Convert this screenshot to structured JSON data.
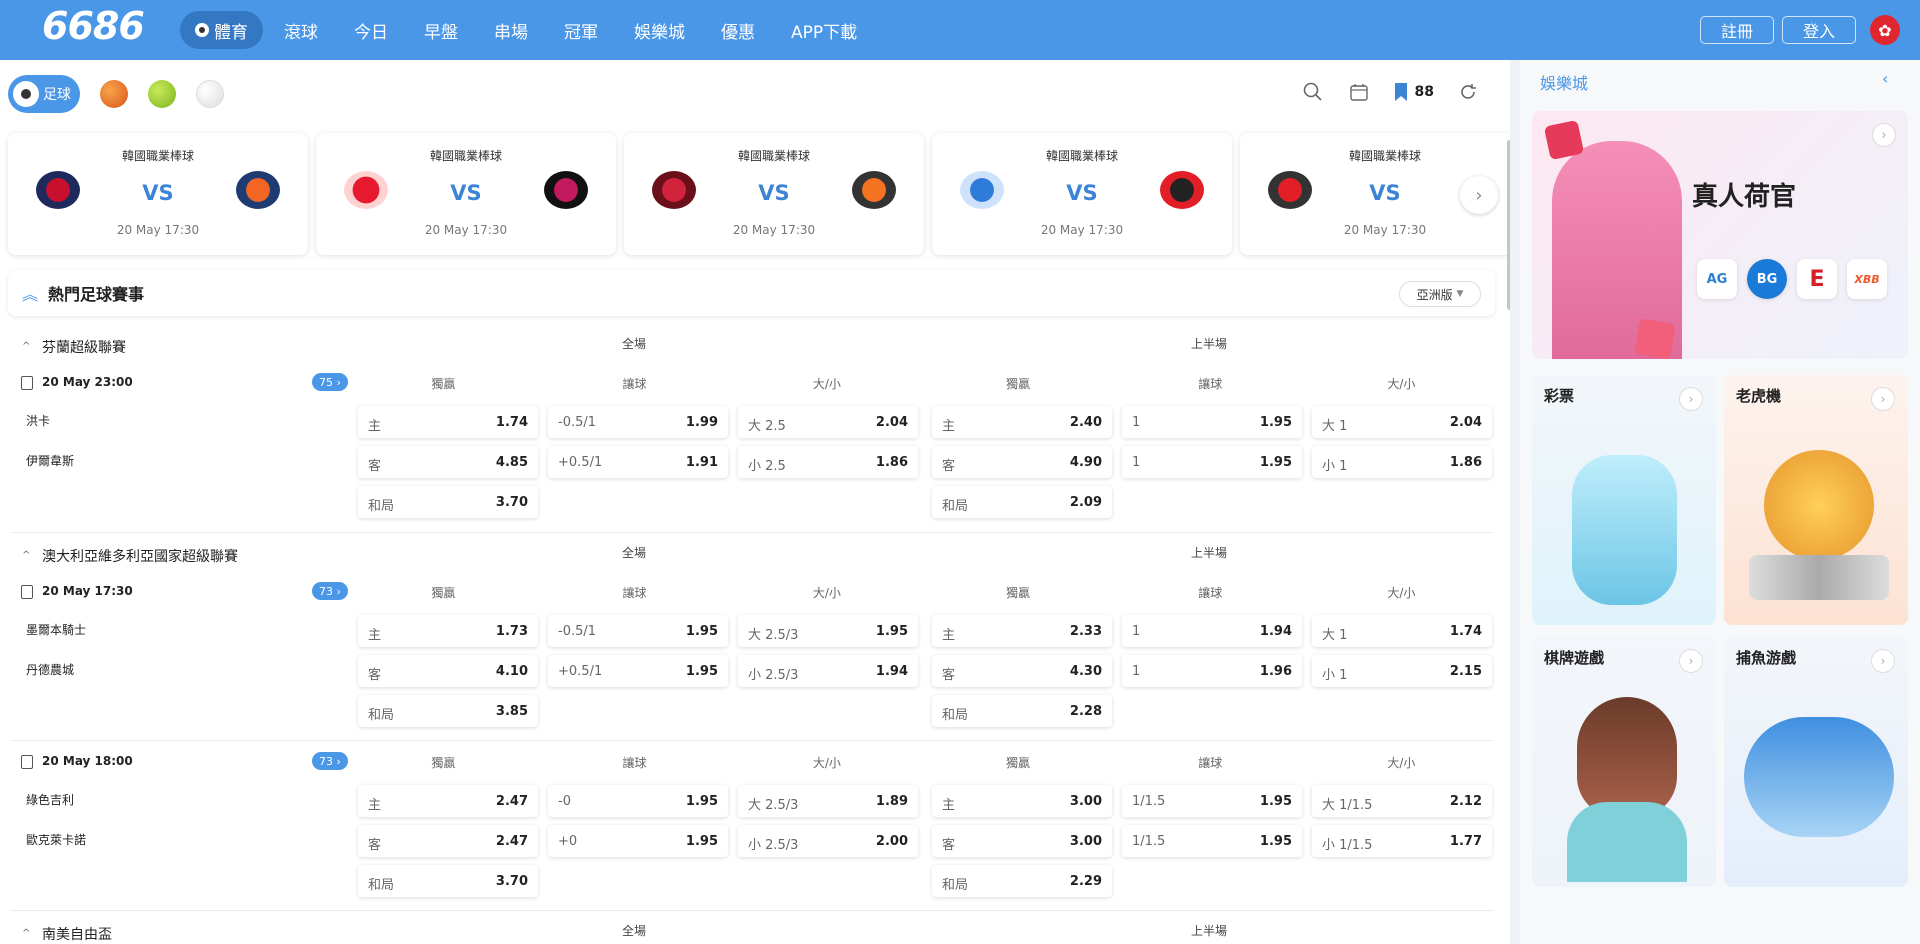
{
  "header": {
    "logo": "6686",
    "nav": [
      "體育",
      "滾球",
      "今日",
      "早盤",
      "串場",
      "冠軍",
      "娛樂城",
      "優惠",
      "APP下載"
    ],
    "register": "註冊",
    "login": "登入"
  },
  "sports": {
    "active": "足球",
    "icons": [
      "basketball-icon",
      "tennis-icon",
      "baseball-icon"
    ]
  },
  "tools": {
    "favorites_count": "88"
  },
  "featured": [
    {
      "league": "韓國職業棒球",
      "vs": "VS",
      "time": "20 May 17:30"
    },
    {
      "league": "韓國職業棒球",
      "vs": "VS",
      "time": "20 May 17:30"
    },
    {
      "league": "韓國職業棒球",
      "vs": "VS",
      "time": "20 May 17:30"
    },
    {
      "league": "韓國職業棒球",
      "vs": "VS",
      "time": "20 May 17:30"
    },
    {
      "league": "韓國職業棒球",
      "vs": "VS",
      "time": "20 May 17:30"
    }
  ],
  "hot": {
    "title": "熱門足球賽事",
    "version": "亞洲版"
  },
  "labels": {
    "full": "全場",
    "half": "上半場",
    "win": "獨贏",
    "handicap": "讓球",
    "ou": "大/小",
    "home": "主",
    "away": "客",
    "draw": "和局"
  },
  "leagues": [
    {
      "name": "芬蘭超級聯賽"
    },
    {
      "name": "澳大利亞維多利亞國家超級聯賽"
    },
    {
      "name": "南美自由盃"
    }
  ],
  "matches": [
    {
      "date": "20 May 23:00",
      "count": "75 ›",
      "home": "洪卡",
      "away": "伊爾韋斯",
      "full": {
        "win": [
          "1.74",
          "4.85",
          "3.70"
        ],
        "hcp_lines": [
          "-0.5/1",
          "+0.5/1"
        ],
        "hcp": [
          "1.99",
          "1.91"
        ],
        "ou_lines": [
          "大 2.5",
          "小 2.5"
        ],
        "ou": [
          "2.04",
          "1.86"
        ]
      },
      "half": {
        "win": [
          "2.40",
          "4.90",
          "2.09"
        ],
        "hcp_lines": [
          "1",
          "1"
        ],
        "hcp": [
          "1.95",
          "1.95"
        ],
        "ou_lines": [
          "大 1",
          "小 1"
        ],
        "ou": [
          "2.04",
          "1.86"
        ]
      }
    },
    {
      "date": "20 May 17:30",
      "count": "73 ›",
      "home": "墨爾本騎士",
      "away": "丹德農城",
      "full": {
        "win": [
          "1.73",
          "4.10",
          "3.85"
        ],
        "hcp_lines": [
          "-0.5/1",
          "+0.5/1"
        ],
        "hcp": [
          "1.95",
          "1.95"
        ],
        "ou_lines": [
          "大 2.5/3",
          "小 2.5/3"
        ],
        "ou": [
          "1.95",
          "1.94"
        ]
      },
      "half": {
        "win": [
          "2.33",
          "4.30",
          "2.28"
        ],
        "hcp_lines": [
          "1",
          "1"
        ],
        "hcp": [
          "1.94",
          "1.96"
        ],
        "ou_lines": [
          "大 1",
          "小 1"
        ],
        "ou": [
          "1.74",
          "2.15"
        ]
      }
    },
    {
      "date": "20 May 18:00",
      "count": "73 ›",
      "home": "綠色吉利",
      "away": "歐克萊卡諾",
      "full": {
        "win": [
          "2.47",
          "2.47",
          "3.70"
        ],
        "hcp_lines": [
          "-0",
          "+0"
        ],
        "hcp": [
          "1.95",
          "1.95"
        ],
        "ou_lines": [
          "大 2.5/3",
          "小 2.5/3"
        ],
        "ou": [
          "1.89",
          "2.00"
        ]
      },
      "half": {
        "win": [
          "3.00",
          "3.00",
          "2.29"
        ],
        "hcp_lines": [
          "1/1.5",
          "1/1.5"
        ],
        "hcp": [
          "1.95",
          "1.95"
        ],
        "ou_lines": [
          "大 1/1.5",
          "小 1/1.5"
        ],
        "ou": [
          "2.12",
          "1.77"
        ]
      }
    }
  ],
  "casino": {
    "title": "娛樂城",
    "banner": "真人荷官",
    "providers": [
      "AG",
      "BG",
      "E",
      "XBB"
    ],
    "tiles": [
      "彩票",
      "老虎機",
      "棋牌遊戲",
      "捕魚游戲"
    ]
  },
  "colors": {
    "brand": "#4a97e8"
  }
}
